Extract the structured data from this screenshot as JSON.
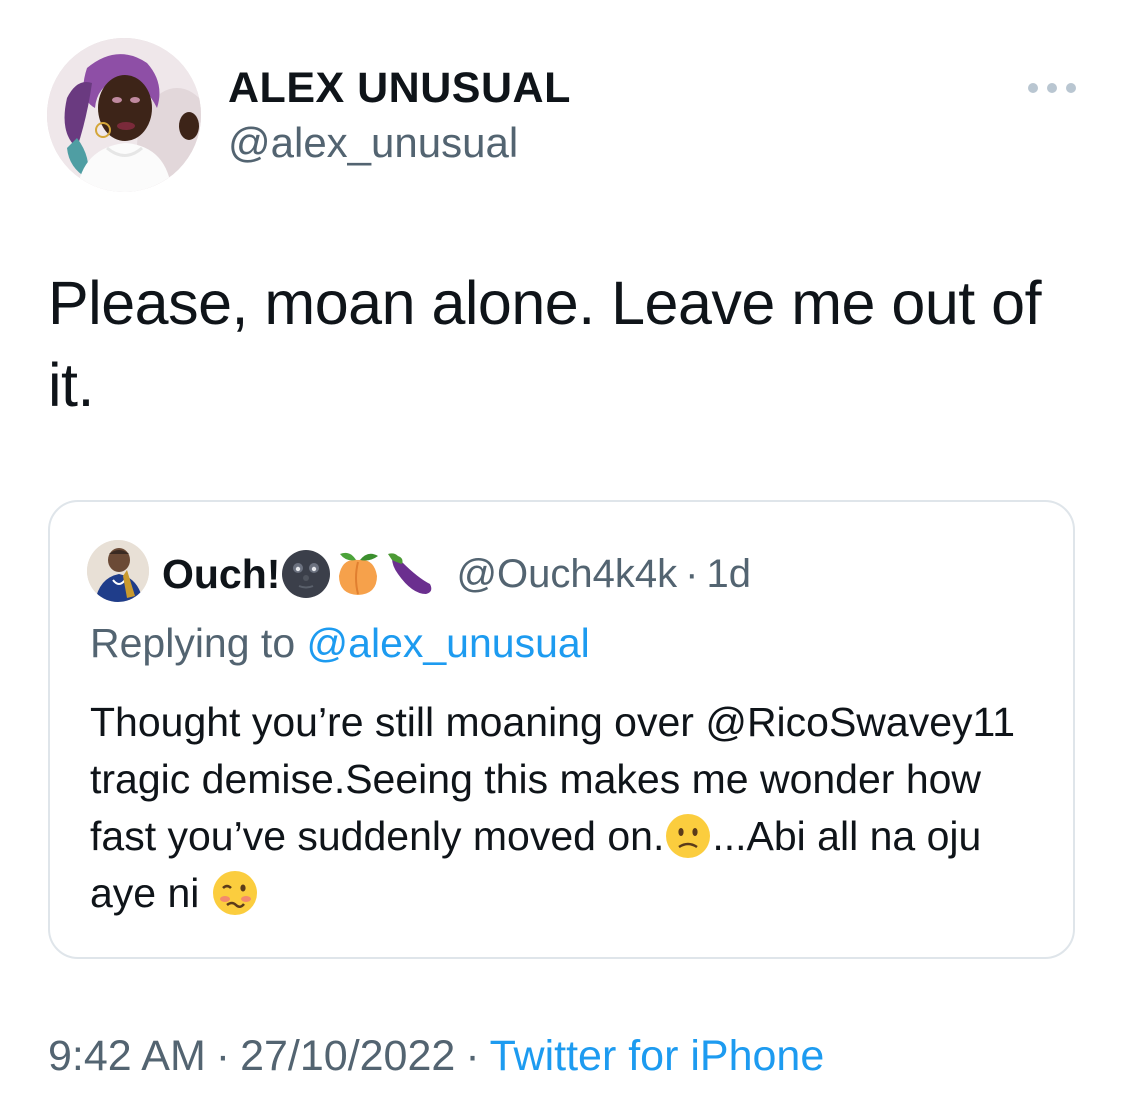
{
  "author": {
    "name": "ALEX UNUSUAL",
    "handle": "@alex_unusual",
    "avatar_icon": "profile-photo-woman-purple-hair"
  },
  "more_icon": "ellipsis-icon",
  "tweet": {
    "text": "Please, moan alone. Leave me out of it."
  },
  "quoted_tweet": {
    "name": "Ouch!",
    "name_emojis": [
      "new-moon-face",
      "peach",
      "eggplant"
    ],
    "handle": "@Ouch4k4k",
    "separator": "·",
    "time": "1d",
    "replying_prefix": "Replying to",
    "replying_to": "@alex_unusual",
    "text_part1": "Thought you’re still moaning over @RicoSwavey11 tragic demise.Seeing this makes me wonder how fast you’ve suddenly moved on.",
    "text_part2": "...Abi all na oju aye ni",
    "text_emojis": [
      "slightly-frowning-face",
      "woozy-face"
    ]
  },
  "footer": {
    "time": "9:42 AM",
    "separator": "·",
    "date": "27/10/2022",
    "source": "Twitter for iPhone"
  },
  "colors": {
    "text": "#0f1419",
    "secondary": "#536471",
    "link": "#1d9bf0",
    "border": "#dfe5ea"
  }
}
